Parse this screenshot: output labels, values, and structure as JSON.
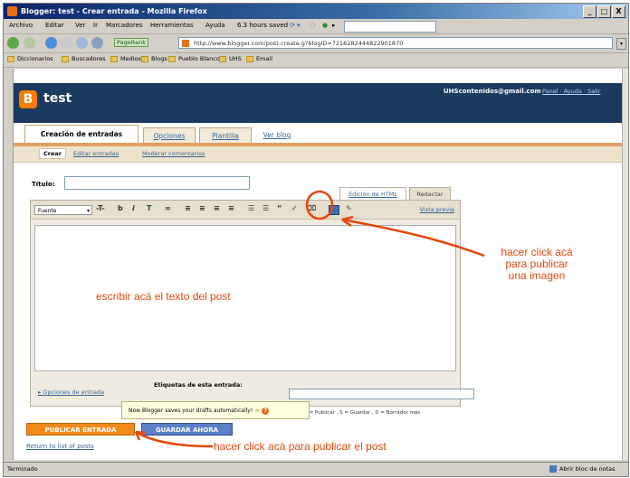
{
  "window": {
    "title": "Blogger: test - Crear entrada - Mozilla Firefox",
    "controls": [
      "_",
      "□",
      "X"
    ]
  },
  "menu": [
    "Archivo",
    "Editar",
    "Ver",
    "Ir",
    "Marcadores",
    "Herramientas",
    "Ayuda",
    "6.3 hours saved"
  ],
  "nav": {
    "pagerank_label": "PageRank",
    "url": "http://www.blogger.com/post-create.g?blogID=7216282444822901870"
  },
  "bookmarks": [
    "Diccionarios",
    "Buscadores",
    "Medios",
    "Blogs",
    "Pueblo Blanco",
    "UHS",
    "Email"
  ],
  "blogger": {
    "logo_letter": "B",
    "blog_title": "test",
    "email": "UHScontenidos@gmail.com",
    "links": "Panel · Ayuda · Salir"
  },
  "tabs": [
    "Creación de entradas",
    "Opciones",
    "Plantilla",
    "Ver blog"
  ],
  "subtabs": [
    "Crear",
    "Editar entradas",
    "Moderar comentarios"
  ],
  "editor": {
    "title_label": "Título:",
    "mode_html": "Edición de HTML",
    "mode_compose": "Redactar",
    "font_label": "Fuente",
    "preview_link": "Vista previa",
    "options_link": "Opciones de entrada",
    "labels_label": "Etiquetas de esta entrada:",
    "shortcuts": "...s, P = Publicar , S = Guardar , D = Borrador  más",
    "tooltip": "Now Blogger saves your drafts automatically!"
  },
  "buttons": {
    "publish": "PUBLICAR ENTRADA",
    "save": "GUARDAR AHORA"
  },
  "return_link": "Return to list of posts",
  "status": {
    "left": "Terminado",
    "right": "Abrir bloc de notas"
  },
  "annotations": {
    "image": "hacer click acá\npara publicar\nuna imagen",
    "text": "escribir acá el texto del post",
    "publish": "hacer click acá para publicar el post"
  },
  "colors": {
    "annotation": "#e2480c",
    "blogger_header": "#1b3a5f",
    "publish_button": "#f28a1a",
    "save_button": "#5b7fc9"
  }
}
